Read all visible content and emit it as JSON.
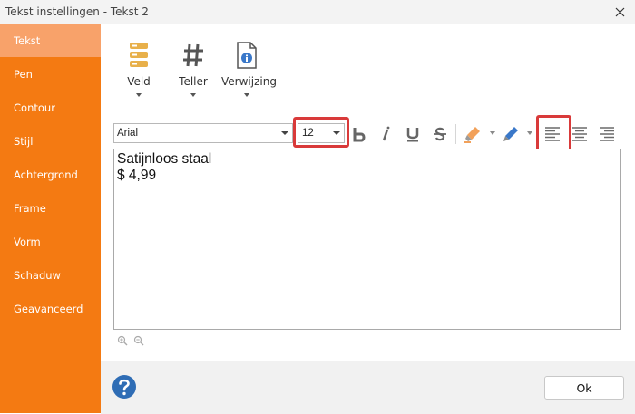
{
  "window": {
    "title": "Tekst instellingen - Tekst 2"
  },
  "sidebar": {
    "items": [
      {
        "label": "Tekst",
        "active": true
      },
      {
        "label": "Pen"
      },
      {
        "label": "Contour"
      },
      {
        "label": "Stijl"
      },
      {
        "label": "Achtergrond"
      },
      {
        "label": "Frame"
      },
      {
        "label": "Vorm"
      },
      {
        "label": "Schaduw"
      },
      {
        "label": "Geavanceerd"
      }
    ]
  },
  "insert": {
    "field_label": "Veld",
    "counter_label": "Teller",
    "reference_label": "Verwijzing"
  },
  "format": {
    "font": "Arial",
    "size": "12",
    "active_alignment": "left",
    "highlight_color": "#f2a15a",
    "pen_color": "#3a78c9"
  },
  "editor": {
    "lines": [
      "Satijnloos staal",
      "$ 4,99"
    ]
  },
  "footer": {
    "ok_label": "Ok"
  },
  "colors": {
    "sidebar": "#f47a12",
    "sidebar_active": "#f8a26a",
    "highlight_box": "#d93a3a"
  }
}
